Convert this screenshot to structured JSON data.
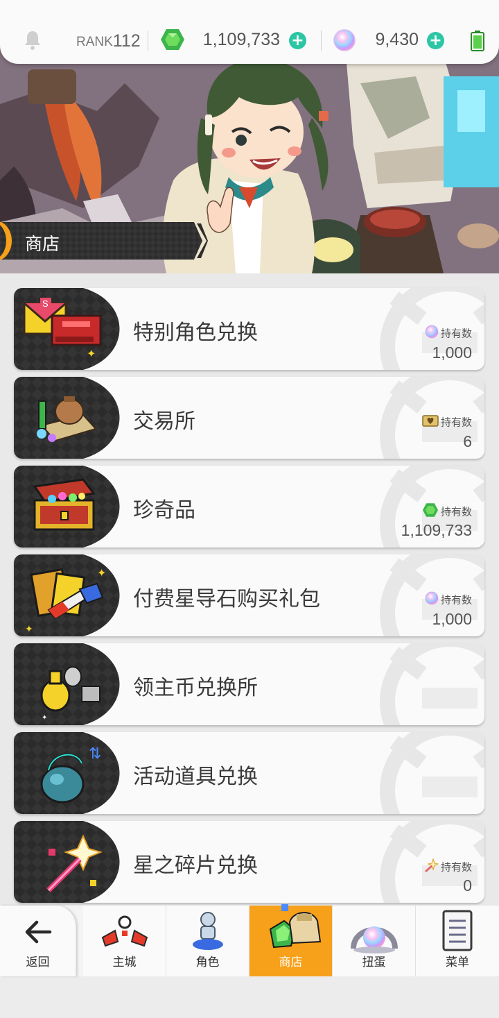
{
  "status_bar": {
    "rank_label": "RANK",
    "rank_value": "112",
    "gems": "1,109,733",
    "orbs": "9,430",
    "icons": [
      "bell-icon",
      "green-gem-icon",
      "plus-icon",
      "rainbow-orb-icon",
      "battery-icon"
    ],
    "accent_color": "#2cc6a5"
  },
  "banner": {
    "title": "商店"
  },
  "shop_items": [
    {
      "title": "特别角色兑换",
      "owned_label": "持有数",
      "owned_icon": "rainbow-orb-icon",
      "count": "1,000"
    },
    {
      "title": "交易所",
      "owned_label": "持有数",
      "owned_icon": "heart-ticket-icon",
      "count": "6"
    },
    {
      "title": "珍奇品",
      "owned_label": "持有数",
      "owned_icon": "green-gem-icon",
      "count": "1,109,733"
    },
    {
      "title": "付费星导石购买礼包",
      "owned_label": "持有数",
      "owned_icon": "rainbow-orb-icon",
      "count": "1,000"
    },
    {
      "title": "领主币兑换所",
      "owned_label": "",
      "owned_icon": "",
      "count": ""
    },
    {
      "title": "活动道具兑换",
      "owned_label": "",
      "owned_icon": "",
      "count": ""
    },
    {
      "title": "星之碎片兑换",
      "owned_label": "持有数",
      "owned_icon": "star-shard-icon",
      "count": "0"
    }
  ],
  "bottom_nav": {
    "back": "返回",
    "home": "主城",
    "characters": "角色",
    "shop": "商店",
    "gacha": "扭蛋",
    "menu": "菜单",
    "active_color": "#f7a01a"
  }
}
